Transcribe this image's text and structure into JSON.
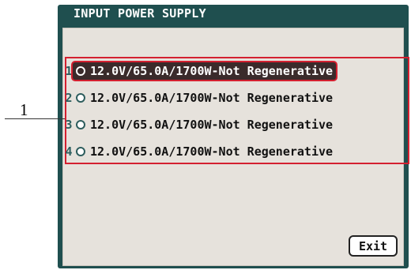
{
  "window": {
    "title": "INPUT POWER SUPPLY"
  },
  "callout": {
    "label": "1"
  },
  "options": [
    {
      "number": "1",
      "label": "12.0V/65.0A/1700W-Not Regenerative",
      "selected": true
    },
    {
      "number": "2",
      "label": "12.0V/65.0A/1700W-Not Regenerative",
      "selected": false
    },
    {
      "number": "3",
      "label": "12.0V/65.0A/1700W-Not Regenerative",
      "selected": false
    },
    {
      "number": "4",
      "label": "12.0V/65.0A/1700W-Not Regenerative",
      "selected": false
    }
  ],
  "exit_button": {
    "label": "Exit"
  },
  "colors": {
    "frame": "#1f4f4f",
    "screen": "#e6e2dc",
    "highlight_border": "#d42030",
    "selected_bg": "#3a2b2b"
  },
  "icons": {
    "option_marker": "radio-button-icon"
  }
}
